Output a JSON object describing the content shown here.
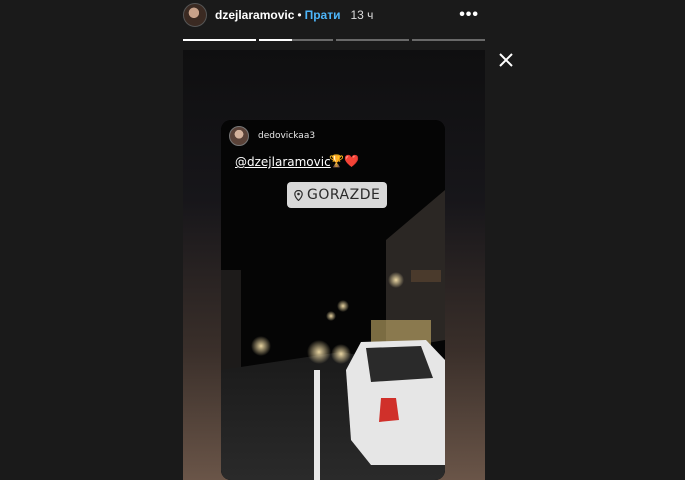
{
  "header": {
    "username": "dzejlaramovic",
    "separator": "•",
    "follow_label": "Прати",
    "time": "13 ч",
    "more": "•••"
  },
  "progress": [
    1,
    0.45,
    0,
    0
  ],
  "video": {
    "username": "dedovickaa3",
    "mention": "@dzejlaramovic",
    "emojis": "🏆❤️",
    "location": "GORAZDE"
  }
}
